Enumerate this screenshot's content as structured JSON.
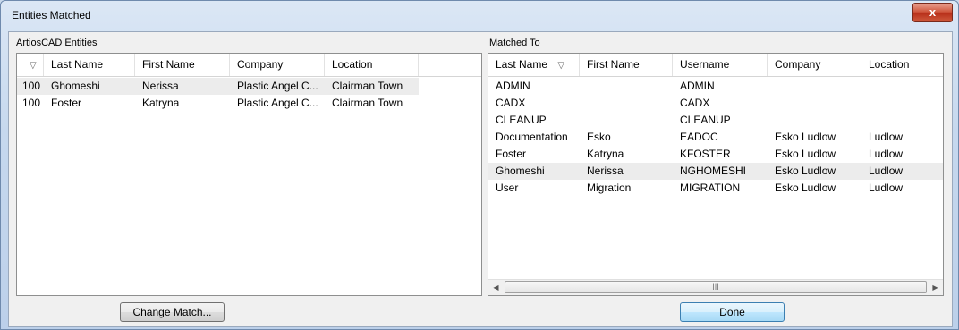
{
  "window": {
    "title": "Entities Matched",
    "close_label": "x"
  },
  "left": {
    "group_label": "ArtiosCAD Entities",
    "sort_indicator": "▽",
    "columns": [
      "Last Name",
      "First Name",
      "Company",
      "Location"
    ],
    "rows": [
      {
        "num": "100",
        "cells": [
          "Ghomeshi",
          "Nerissa",
          "Plastic Angel C...",
          "Clairman Town"
        ],
        "selected": true
      },
      {
        "num": "100",
        "cells": [
          "Foster",
          "Katryna",
          "Plastic Angel C...",
          "Clairman Town"
        ],
        "selected": false
      }
    ]
  },
  "right": {
    "group_label": "Matched To",
    "sort_indicator": "▽",
    "columns": [
      "Last Name",
      "First Name",
      "Username",
      "Company",
      "Location"
    ],
    "rows": [
      {
        "cells": [
          "ADMIN",
          "",
          "ADMIN",
          "",
          ""
        ],
        "selected": false
      },
      {
        "cells": [
          "CADX",
          "",
          "CADX",
          "",
          ""
        ],
        "selected": false
      },
      {
        "cells": [
          "CLEANUP",
          "",
          "CLEANUP",
          "",
          ""
        ],
        "selected": false
      },
      {
        "cells": [
          "Documentation",
          "Esko",
          "EADOC",
          "Esko Ludlow",
          "Ludlow"
        ],
        "selected": false
      },
      {
        "cells": [
          "Foster",
          "Katryna",
          "KFOSTER",
          "Esko Ludlow",
          "Ludlow"
        ],
        "selected": false
      },
      {
        "cells": [
          "Ghomeshi",
          "Nerissa",
          "NGHOMESHI",
          "Esko Ludlow",
          "Ludlow"
        ],
        "selected": true
      },
      {
        "cells": [
          "User",
          "Migration",
          "MIGRATION",
          "Esko Ludlow",
          "Ludlow"
        ],
        "selected": false
      }
    ],
    "scroll_thumb_grip": "III",
    "scroll_left": "◀",
    "scroll_right": "▶"
  },
  "buttons": {
    "change_match": "Change Match...",
    "done": "Done"
  }
}
